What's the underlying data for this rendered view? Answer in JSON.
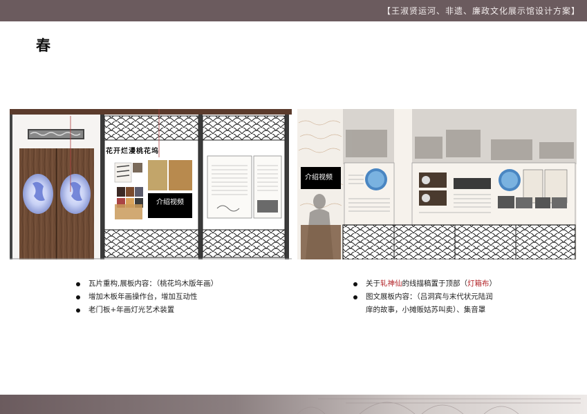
{
  "header": {
    "title": "【王淑贤运河、非遗、廉政文化展示馆设计方案】"
  },
  "page": {
    "season": "春"
  },
  "left_panel": {
    "caption": "花开烂漫桃花坞",
    "video_label": "介绍视频"
  },
  "right_panel": {
    "video_label": "介绍视频"
  },
  "left_bullets": [
    "瓦片重构,展板内容：（桃花坞木版年画）",
    "增加木板年画操作台，增加互动性",
    "老门板+年画灯光艺术装置"
  ],
  "right_bullets": {
    "item1_pre": "关于",
    "item1_name": "轧神仙",
    "item1_mid": "的线描稿置于顶部（",
    "item1_highlight": "灯箱布",
    "item1_post": "）",
    "item2_line1": "图文展板内容：（吕洞宾与末代状元陆润",
    "item2_line2": "庠的故事，小摊贩姑苏叫卖）、集音罩"
  },
  "colors": {
    "header_bar": "#6b5b5e",
    "accent_red": "#b3262a",
    "frame_dark": "#333333",
    "door_wood": "#6b4a34"
  }
}
